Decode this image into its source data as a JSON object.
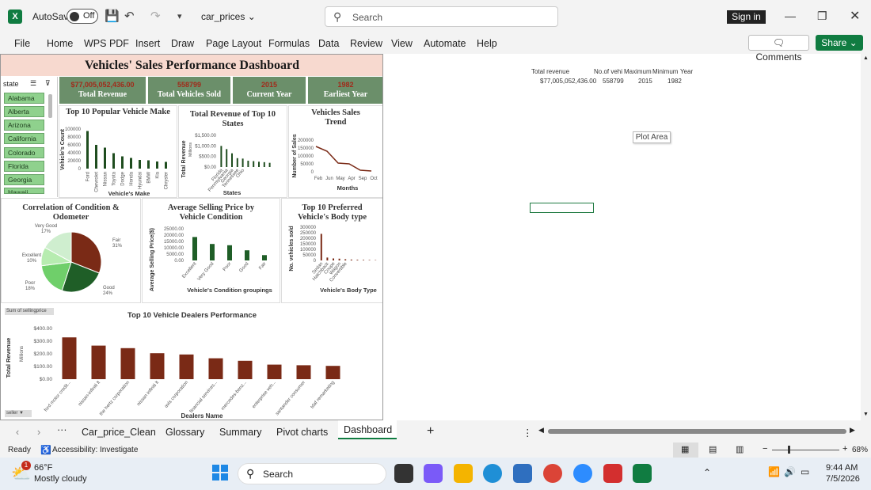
{
  "titlebar": {
    "autosave": "AutoSave",
    "toggle": "Off",
    "filename": "car_prices",
    "search_placeholder": "Search",
    "signin": "Sign in"
  },
  "menu": [
    "File",
    "Home",
    "WPS PDF",
    "Insert",
    "Draw",
    "Page Layout",
    "Formulas",
    "Data",
    "Review",
    "View",
    "Automate",
    "Help"
  ],
  "actions": {
    "comments": "Comments",
    "share": "Share"
  },
  "dashboard": {
    "title": "Vehicles' Sales Performance Dashboard",
    "kpis": [
      {
        "value": "$77,005,052,436.00",
        "label": "Total Revenue"
      },
      {
        "value": "558799",
        "label": "Total Vehicles Sold"
      },
      {
        "value": "2015",
        "label": "Current Year"
      },
      {
        "value": "1982",
        "label": "Earliest Year"
      }
    ],
    "slicer": {
      "header": "state",
      "items": [
        "Alabama",
        "Alberta",
        "Arizona",
        "California",
        "Colorado",
        "Florida",
        "Georgia",
        "Hawaii"
      ]
    },
    "pivot_buttons": {
      "sum": "Sum of sellingprice",
      "seller": "seller"
    }
  },
  "chart_data": [
    {
      "type": "bar",
      "title": "Top 10 Popular Vehicle Make",
      "xlabel": "Vehicle's Make",
      "ylabel": "Vehicle's Count",
      "categories": [
        "Ford",
        "Chevrolet",
        "Nissan",
        "Toyota",
        "Dodge",
        "Honda",
        "Hyundai",
        "BMW",
        "Kia",
        "Chrysler"
      ],
      "values": [
        95000,
        60000,
        53000,
        39000,
        31000,
        27000,
        22000,
        21000,
        18000,
        17000
      ],
      "yticks": [
        "100000",
        "80000",
        "60000",
        "40000",
        "20000",
        "0"
      ],
      "ylim": [
        0,
        100000
      ]
    },
    {
      "type": "bar",
      "title": "Total Revenue of Top 10 States",
      "xlabel": "States",
      "ylabel": "Total Revenue",
      "yunit": "Millions",
      "categories": [
        "Florida",
        "Pennsylvania",
        "Georgia",
        "Tennessee",
        "Ohio",
        "",
        "",
        " ",
        "  ",
        "   "
      ],
      "values": [
        1000,
        850,
        650,
        420,
        400,
        300,
        280,
        250,
        230,
        200
      ],
      "tick_labels": [
        "Florida",
        "Pennsylvania",
        "Georgia",
        "Tennessee",
        "Ohio"
      ],
      "yticks": [
        "$1,500.00",
        "$1,000.00",
        "$500.00",
        "$0.00"
      ],
      "ylim": [
        0,
        1500
      ]
    },
    {
      "type": "line",
      "title": "Vehicles Sales Trend",
      "xlabel": "Months",
      "ylabel": "Number of Sales",
      "categories": [
        "Feb",
        "Jun",
        "May",
        "Apr",
        "Sep",
        "Oct"
      ],
      "values": [
        160000,
        130000,
        55000,
        50000,
        10000,
        5000
      ],
      "yticks": [
        "200000",
        "150000",
        "100000",
        "50000",
        "0"
      ],
      "ylim": [
        0,
        200000
      ]
    },
    {
      "type": "pie",
      "title": "Correlation of Condition & Odometer",
      "labels": [
        "Fair",
        "Good",
        "Poor",
        "Excellent",
        "Very Good"
      ],
      "values": [
        31,
        24,
        18,
        10,
        17
      ],
      "label_text": [
        "Fair 31%",
        "Good 24%",
        "Poor 18%",
        "Excellent 10%",
        "Very Good 17%"
      ],
      "colors": [
        "#7a2a16",
        "#1f5e27",
        "#6fcf6a",
        "#b7ecb0",
        "#cfeecf"
      ]
    },
    {
      "type": "bar",
      "title": "Average Selling Price by Vehicle Condition",
      "xlabel": "Vehicle's Condition groupings",
      "ylabel": "Average Selling Price($)",
      "categories": [
        "Excellent",
        "Very Good",
        "Poor",
        "Good",
        "Fair"
      ],
      "values": [
        18500,
        13000,
        12000,
        8000,
        4200
      ],
      "yticks": [
        "25000.00",
        "20000.00",
        "15000.00",
        "10000.00",
        "5000.00",
        "0.00"
      ],
      "ylim": [
        0,
        25000
      ]
    },
    {
      "type": "bar",
      "title": "Top 10 Preferred Vehicle's Body type",
      "xlabel": "Vehicle's Body Type",
      "ylabel": "No. vehicles sold",
      "categories": [
        "Sedan",
        "Hatchback",
        "Coupe",
        "Wagon",
        "Convertible",
        "",
        "",
        "",
        "",
        " "
      ],
      "values": [
        240000,
        26000,
        18000,
        16000,
        11000,
        8000,
        6000,
        5000,
        4000,
        3000
      ],
      "tick_labels": [
        "Sedan",
        "Hatchback",
        "Coupe",
        "Wagon",
        "Convertible"
      ],
      "yticks": [
        "300000",
        "250000",
        "200000",
        "150000",
        "100000",
        "50000",
        "0"
      ],
      "ylim": [
        0,
        300000
      ]
    },
    {
      "type": "bar",
      "title": "Top 10 Vehicle Dealers Performance",
      "xlabel": "Dealers Name",
      "ylabel": "Total Revenue",
      "yunit": "Millions",
      "categories": [
        "ford motor credit...",
        "nissan-infiniti lt",
        "the hertz corporation",
        "nissan infiniti lt",
        "avis corporation",
        "financial services...",
        "mercedes-benz...",
        "enterprise veh...",
        "santander consumer",
        "tdaf remarketing"
      ],
      "values": [
        330,
        265,
        245,
        205,
        195,
        165,
        145,
        115,
        110,
        105
      ],
      "yticks": [
        "$400.00",
        "$300.00",
        "$200.00",
        "$100.00",
        "$0.00"
      ],
      "ylim": [
        0,
        400
      ]
    }
  ],
  "sheet": {
    "headers": [
      "Total revenue",
      "No.of vehi",
      "Maximum",
      "Minimum",
      "Year"
    ],
    "values": [
      "$77,005,052,436.00",
      "558799",
      "2015",
      "1982"
    ],
    "plot_area": "Plot Area"
  },
  "tabs": [
    "Car_price_Clean",
    "Glossary",
    "Summary",
    "Pivot charts",
    "Dashboard"
  ],
  "status": {
    "ready": "Ready",
    "accessibility": "Accessibility: Investigate",
    "zoom": "68%"
  },
  "taskbar": {
    "temp": "66°F",
    "weather": "Mostly cloudy",
    "search": "Search",
    "time": "9:44 AM",
    "date": "7/5/2026",
    "badge": "1"
  }
}
